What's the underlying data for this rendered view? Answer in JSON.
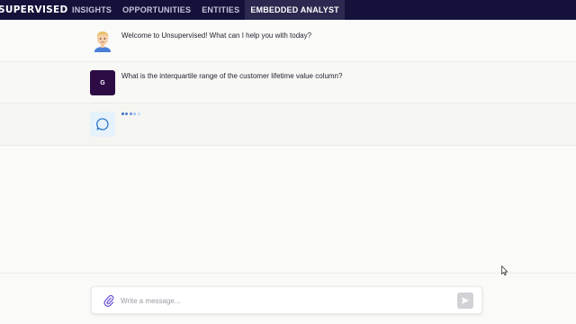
{
  "nav": {
    "brand": "SUPERVISED",
    "tabs": [
      {
        "label": "INSIGHTS",
        "active": false
      },
      {
        "label": "OPPORTUNITIES",
        "active": false
      },
      {
        "label": "ENTITIES",
        "active": false
      },
      {
        "label": "EMBEDDED ANALYST",
        "active": true
      }
    ]
  },
  "messages": [
    {
      "sender": "assistant",
      "avatar_icon": "memoji-avatar-icon",
      "text": "Welcome to Unsupervised! What can I help you with today?"
    },
    {
      "sender": "user",
      "avatar_initial": "G",
      "text": "What is the interquartile range of the customer lifetime value column?"
    },
    {
      "sender": "assistant",
      "avatar_icon": "chat-bubble-icon",
      "status": "typing"
    }
  ],
  "composer": {
    "placeholder": "Write a message...",
    "attach_icon": "paperclip-icon",
    "send_icon": "send-icon"
  },
  "colors": {
    "nav_bg": "#14123a",
    "nav_active_bg": "#2b2950",
    "user_avatar_bg": "#2d0b45",
    "assistant_avatar_bg": "#e6f2fb",
    "typing_dots": "#3a6fd0",
    "attach_icon": "#6a4ed6"
  }
}
